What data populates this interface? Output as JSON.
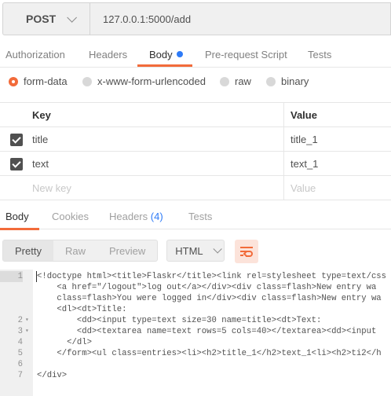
{
  "request": {
    "method": "POST",
    "url": "127.0.0.1:5000/add"
  },
  "request_tabs": {
    "authorization": "Authorization",
    "headers": "Headers",
    "body": "Body",
    "pre_request": "Pre-request Script",
    "tests": "Tests"
  },
  "body_modes": {
    "form_data": "form-data",
    "urlencoded": "x-www-form-urlencoded",
    "raw": "raw",
    "binary": "binary",
    "selected": "form-data"
  },
  "params_table": {
    "key_header": "Key",
    "value_header": "Value",
    "rows": [
      {
        "key": "title",
        "value": "title_1",
        "checked": true
      },
      {
        "key": "text",
        "value": "text_1",
        "checked": true
      }
    ],
    "new_key_placeholder": "New key",
    "new_value_placeholder": "Value"
  },
  "response_tabs": {
    "body": "Body",
    "cookies": "Cookies",
    "headers": "Headers",
    "headers_count": "(4)",
    "tests": "Tests"
  },
  "view": {
    "pretty": "Pretty",
    "raw": "Raw",
    "preview": "Preview",
    "format": "HTML"
  },
  "code_lines": [
    {
      "num": "1",
      "fold": "",
      "text": "<!doctype html><title>Flaskr</title><link rel=stylesheet type=text/css"
    },
    {
      "num": "",
      "fold": "",
      "text": "    <a href=\"/logout\">log out</a></div><div class=flash>New entry wa"
    },
    {
      "num": "",
      "fold": "",
      "text": "    class=flash>You were logged in</div><div class=flash>New entry wa"
    },
    {
      "num": "",
      "fold": "",
      "text": "    <dl><dt>Title:"
    },
    {
      "num": "2",
      "fold": "▾",
      "text": "        <dd><input type=text size=30 name=title><dt>Text:"
    },
    {
      "num": "3",
      "fold": "▾",
      "text": "        <dd><textarea name=text rows=5 cols=40></textarea><dd><input"
    },
    {
      "num": "4",
      "fold": "",
      "text": "      </dl>"
    },
    {
      "num": "5",
      "fold": "",
      "text": "    </form><ul class=entries><li><h2>title_1</h2>text_1<li><h2>ti2</h"
    },
    {
      "num": "6",
      "fold": "",
      "text": ""
    },
    {
      "num": "7",
      "fold": "",
      "text": "</div>"
    }
  ],
  "colors": {
    "accent": "#f26b3a",
    "blue": "#2e7bf7"
  }
}
